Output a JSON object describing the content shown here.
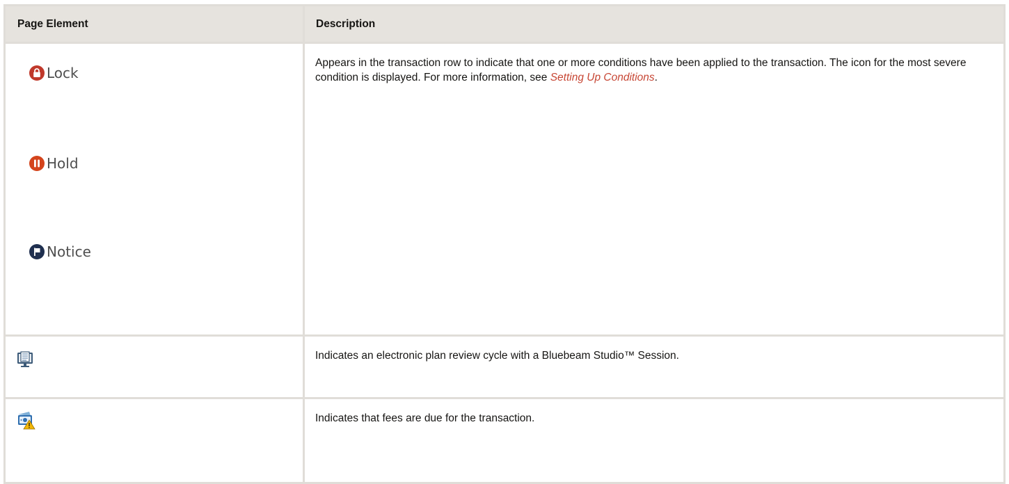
{
  "table": {
    "headers": {
      "element": "Page Element",
      "description": "Description"
    },
    "rows": [
      {
        "conditions": [
          {
            "label": "Lock",
            "icon": "lock-icon",
            "color": "#c0392b"
          },
          {
            "label": "Hold",
            "icon": "pause-icon",
            "color": "#d4441c"
          },
          {
            "label": "Notice",
            "icon": "flag-icon",
            "color": "#1f2f4f"
          }
        ],
        "description_pre": "Appears in the transaction row to indicate that one or more conditions have been applied to the transaction. The icon for the most severe condition is displayed. For more information, see ",
        "description_link": "Setting Up Conditions",
        "description_post": "."
      },
      {
        "icon": "bluebeam-session-icon",
        "description": "Indicates an electronic plan review cycle with a Bluebeam Studio™ Session."
      },
      {
        "icon": "fees-due-icon",
        "description": "Indicates that fees are due for the transaction."
      }
    ]
  },
  "colors": {
    "header_bg": "#e6e3de",
    "border": "#e0ddd8",
    "link": "#c74634"
  }
}
